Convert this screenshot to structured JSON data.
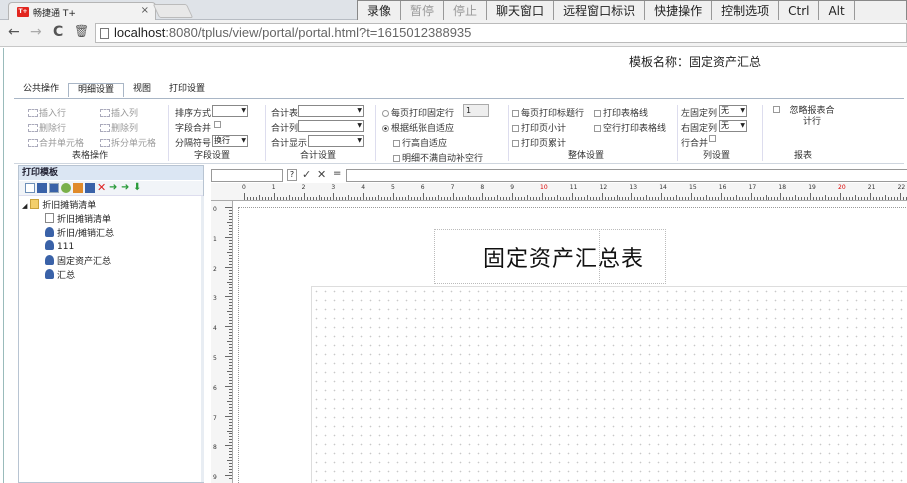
{
  "browser": {
    "tab_logo": "T+",
    "tab_title": "畅捷通 T+",
    "tab_close": "×",
    "back_icon": "←",
    "forward_icon": "→",
    "reload_icon": "C",
    "home_icon": "🗑",
    "url_host": "localhost",
    "url_rest": ":8080/tplus/view/portal/portal.html?t=1615012388935"
  },
  "remote_toolbar": {
    "record": "录像",
    "pause": "暂停",
    "stop": "停止",
    "chat": "聊天窗口",
    "remote_mark": "远程窗口标识",
    "shortcuts": "快捷操作",
    "control": "控制选项",
    "ctrl": "Ctrl",
    "alt": "Alt"
  },
  "template_name": "模板名称：固定资产汇总",
  "tabs": [
    "公共操作",
    "明细设置",
    "视图",
    "打印设置"
  ],
  "ribbon": {
    "table_ops": {
      "caption": "表格操作",
      "insert_row": "插入行",
      "delete_row": "删除行",
      "merge_cells": "合并单元格",
      "insert_col": "插入列",
      "delete_col": "删除列",
      "split_cells": "拆分单元格"
    },
    "field_settings": {
      "caption": "字段设置",
      "sort_label": "排序方式",
      "field_merge": "字段合并",
      "separator_label": "分隔符号",
      "separator_value": "换行"
    },
    "total_settings": {
      "caption": "合计设置",
      "total_table": "合计表",
      "total_col": "合计列",
      "total_display": "合计显示"
    },
    "page_settings": {
      "fixed_rows": "每页打印固定行",
      "fixed_rows_value": "1",
      "auto_fit_paper": "根据纸张自适应",
      "row_height_auto": "行高自适应",
      "no_blank_fill": "明细不满自动补空行"
    },
    "overall": {
      "caption": "整体设置",
      "print_title_rows": "每页打印标题行",
      "print_page_subtotal": "打印页小计",
      "print_page_cumulative": "打印页累计",
      "print_table_lines": "打印表格线",
      "blank_row_lines": "空行打印表格线"
    },
    "column_settings": {
      "caption": "列设置",
      "left_fixed": "左固定列",
      "left_fixed_value": "无",
      "right_fixed": "右固定列",
      "right_fixed_value": "无",
      "row_merge": "行合并"
    },
    "report": {
      "caption": "报表",
      "ignore_total": "忽略报表合计行"
    }
  },
  "left_panel": {
    "title": "打印模板",
    "root": "折旧摊销清单",
    "items": [
      "折旧摊销清单",
      "折旧/摊销汇总",
      "111",
      "固定资产汇总",
      "汇总"
    ]
  },
  "formula_bar": {
    "func_icon": "?",
    "ok": "✓",
    "cancel": "✕",
    "equals": "="
  },
  "ruler_h": [
    "0",
    "1",
    "2",
    "3",
    "4",
    "5",
    "6",
    "7",
    "8",
    "9",
    "10",
    "11",
    "12",
    "13",
    "14",
    "15",
    "16",
    "17",
    "18",
    "19",
    "20",
    "21",
    "22"
  ],
  "ruler_v": [
    "0",
    "1",
    "2",
    "3",
    "4",
    "5",
    "6",
    "7",
    "8",
    "9"
  ],
  "report_title": "固定资产汇总表"
}
